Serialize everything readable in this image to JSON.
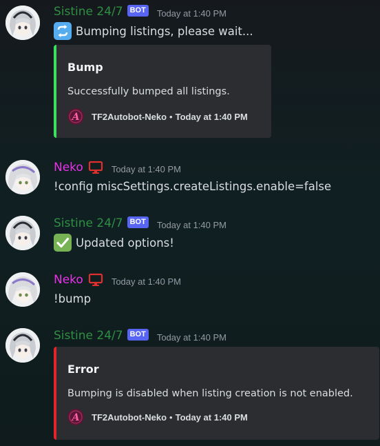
{
  "colors": {
    "sistine_name": "#2f8f43",
    "neko_name": "#e832e8",
    "bot_badge": "#5865f2",
    "success_bar": "#3ce05f",
    "error_bar": "#e3242b",
    "embed_bg": "#2b2d31",
    "monitor_icon": "#e0302e"
  },
  "messages": [
    {
      "author": "Sistine 24/7",
      "badge": "BOT",
      "timestamp": "Today at 1:40 PM",
      "emoji": "repeat-arrows-icon",
      "text": "Bumping listings, please wait...",
      "embed": {
        "title": "Bump",
        "description": "Successfully bumped all listings.",
        "footer_name": "TF2Autobot-Neko",
        "footer_separator": "•",
        "footer_time": "Today at 1:40 PM",
        "footer_icon_letter": "A"
      }
    },
    {
      "author": "Neko",
      "icon": "monitor-icon",
      "timestamp": "Today at 1:40 PM",
      "text": "!config miscSettings.createListings.enable=false"
    },
    {
      "author": "Sistine 24/7",
      "badge": "BOT",
      "timestamp": "Today at 1:40 PM",
      "emoji": "check-mark-icon",
      "text": "Updated options!"
    },
    {
      "author": "Neko",
      "icon": "monitor-icon",
      "timestamp": "Today at 1:40 PM",
      "text": "!bump"
    },
    {
      "author": "Sistine 24/7",
      "badge": "BOT",
      "timestamp": "Today at 1:40 PM",
      "embed": {
        "title": "Error",
        "description": "Bumping is disabled when listing creation is not enabled.",
        "footer_name": "TF2Autobot-Neko",
        "footer_separator": "•",
        "footer_time": "Today at 1:40 PM",
        "footer_icon_letter": "A"
      }
    }
  ]
}
